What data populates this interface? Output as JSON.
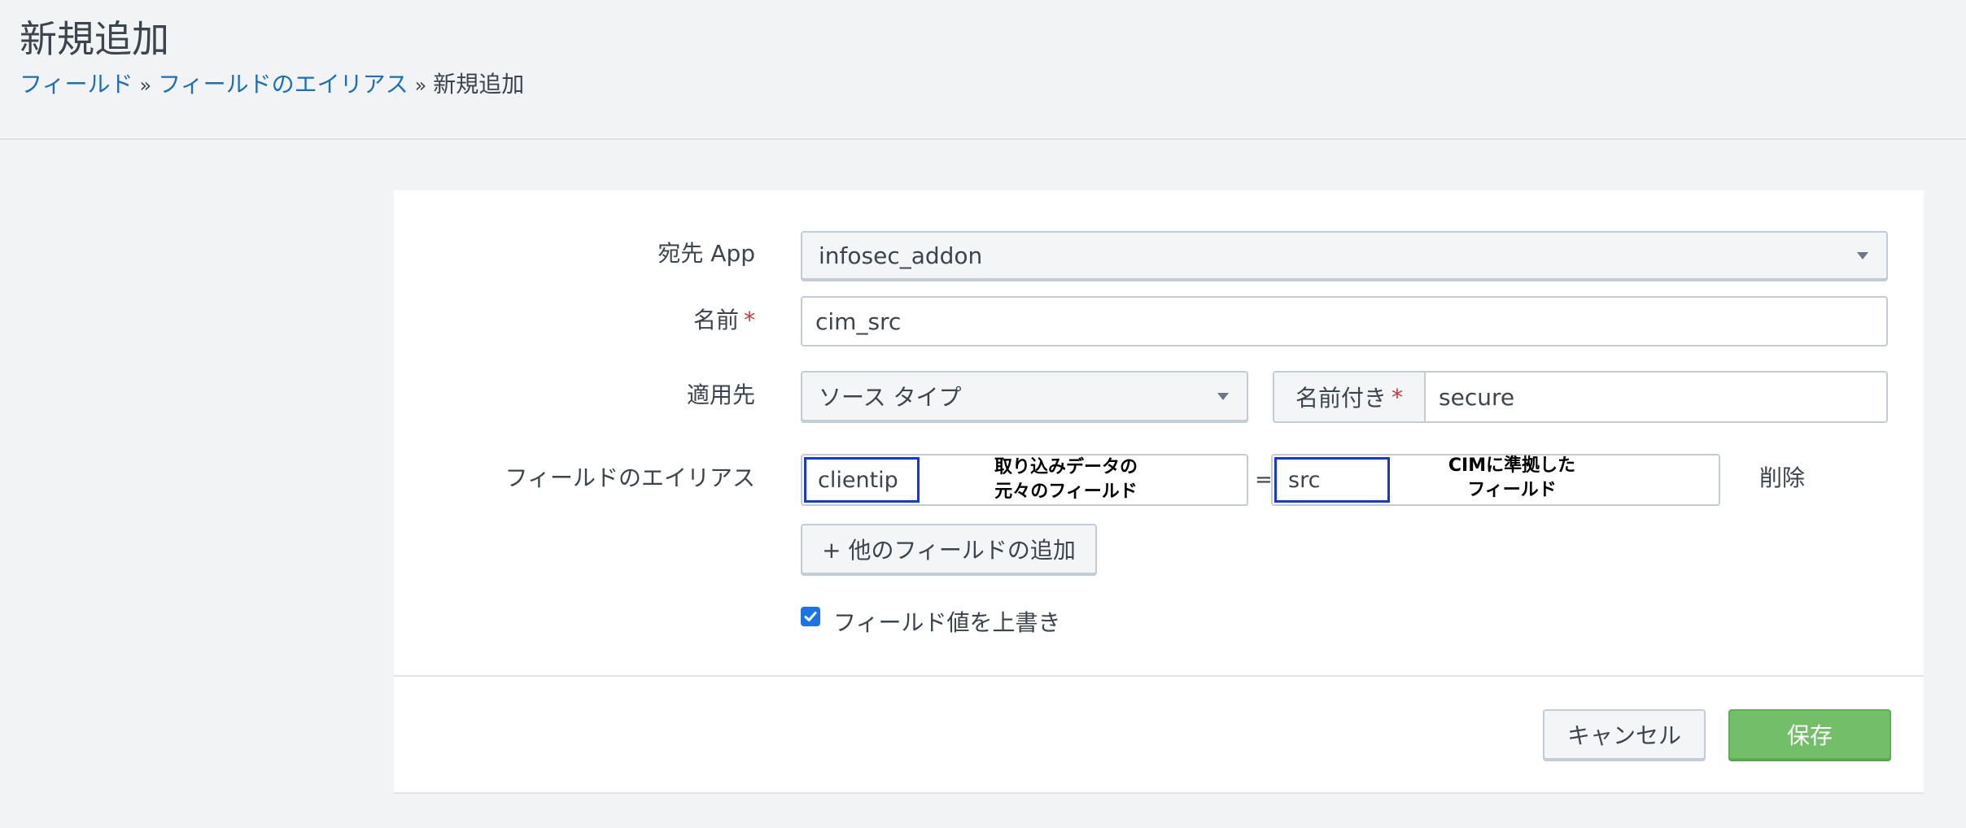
{
  "header": {
    "title": "新規追加",
    "breadcrumb": [
      {
        "label": "フィールド"
      },
      {
        "label": "フィールドのエイリアス"
      },
      {
        "label": "新規追加"
      }
    ],
    "separator": "»"
  },
  "form": {
    "destination_app": {
      "label": "宛先 App",
      "value": "infosec_addon"
    },
    "name": {
      "label": "名前",
      "required_mark": "*",
      "value": "cim_src"
    },
    "apply_to": {
      "label": "適用先",
      "type_value": "ソース タイプ",
      "named_label": "名前付き",
      "named_required_mark": "*",
      "named_value": "secure"
    },
    "field_alias": {
      "label": "フィールドのエイリアス",
      "original_field": "clientip",
      "original_annotation_line1": "取り込みデータの",
      "original_annotation_line2": "元々のフィールド",
      "equals": "=",
      "alias_field": "src",
      "alias_annotation_line1": "CIMに準拠した",
      "alias_annotation_line2": "フィールド",
      "delete_label": "削除",
      "add_field_button": "+ 他のフィールドの追加"
    },
    "overwrite": {
      "label": "フィールド値を上書き",
      "checked": true
    }
  },
  "footer": {
    "cancel_label": "キャンセル",
    "save_label": "保存"
  },
  "colors": {
    "link": "#1e6fb8",
    "required": "#c83b35",
    "primary": "#73bf69",
    "annotation_border": "#1437e0",
    "checkbox": "#1a73e8"
  }
}
